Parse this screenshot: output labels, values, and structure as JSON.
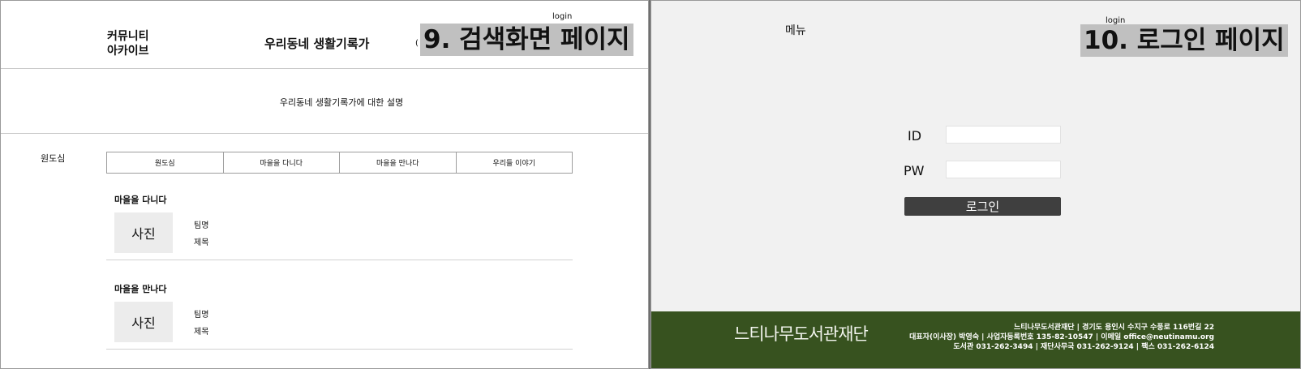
{
  "left": {
    "header": {
      "logo_line1": "커뮤니티",
      "logo_line2": "아카이브",
      "site_title": "우리동네 생활기록가",
      "paren": "(",
      "login": "login",
      "page_label": "9. 검색화면 페이지"
    },
    "description": "우리동네 생활기록가에 대한 설명",
    "side_label": "원도심",
    "tabs": [
      "원도심",
      "마을을 다니다",
      "마을을 만나다",
      "우리들 이야기"
    ],
    "sections": [
      {
        "title": "마을을 다니다",
        "photo": "사진",
        "team": "팀명",
        "subject": "제목"
      },
      {
        "title": "마을을 만나다",
        "photo": "사진",
        "team": "팀명",
        "subject": "제목"
      }
    ]
  },
  "right": {
    "menu": "메뉴",
    "login": "login",
    "page_label": "10. 로그인 페이지",
    "form": {
      "id_label": "ID",
      "pw_label": "PW",
      "id_value": "",
      "pw_value": "",
      "button": "로그인"
    },
    "footer": {
      "brand": "느티나무도서관재단",
      "line1": "느티나무도서관재단 | 경기도 용인시 수지구 수풍로 116번길 22",
      "line2": "대표자(이사장) 박영숙 | 사업자등록번호 135-82-10547 | 이메일 office@neutinamu.org",
      "line3": "도서관 031-262-3494 | 재단사무국 031-262-9124 | 팩스 031-262-6124",
      "bg_color": "#37521f"
    }
  }
}
